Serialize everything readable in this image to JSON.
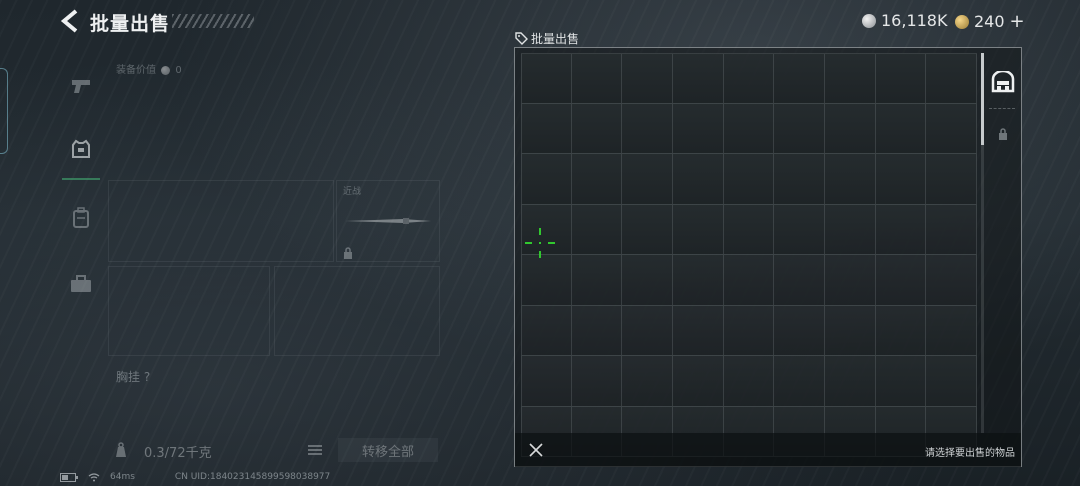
{
  "header": {
    "title": "批量出售",
    "currency_silver": "16,118K",
    "currency_gold": "240",
    "gold_plus": "+"
  },
  "left_panel": {
    "equip_value_label": "装备价值",
    "equip_value": "0",
    "slot_label": "近战",
    "chest_label": "胸挂 ?",
    "capacity": "0.3/72千克",
    "transfer_all": "转移全部"
  },
  "status_bar": {
    "ping": "64ms",
    "uid": "CN UID:1840231458995980389​77"
  },
  "sell_panel": {
    "title": "批量出售",
    "hint": "请选择要出售的物品",
    "grid_cols": 9,
    "grid_rows": 8
  },
  "colors": {
    "accent_green": "#31c82f",
    "tab_active": "#3f9a6a",
    "panel_border": "#c8cdd2"
  },
  "icons": {
    "back": "back-arrow-icon",
    "silver": "silver-coin-icon",
    "gold": "gold-coin-icon",
    "sell": "sell-tag-icon",
    "storage": "storage-icon",
    "lock": "lock-icon",
    "close": "close-icon",
    "crosshair": "crosshair-icon"
  }
}
